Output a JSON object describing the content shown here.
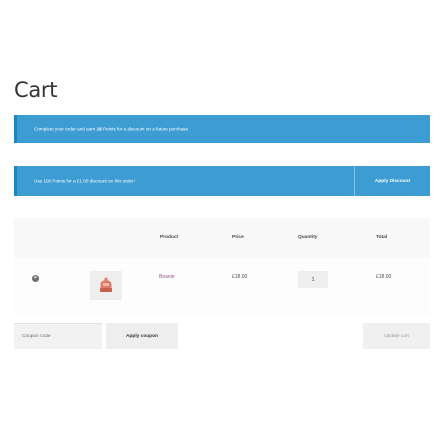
{
  "page": {
    "title": "Cart"
  },
  "notices": {
    "earn": {
      "text_before": "Complete your order and earn ",
      "points": "18",
      "text_after": " Points for a discount on a future purchase"
    },
    "redeem": {
      "text": "Use 100 Points for a £1.00 discount on this order!",
      "button_label": "Apply Discount"
    }
  },
  "cart": {
    "headers": {
      "product": "Product",
      "price": "Price",
      "quantity": "Quantity",
      "total": "Total"
    },
    "items": [
      {
        "remove_symbol": "×",
        "thumbnail_icon": "beanie-product-icon",
        "name": "Beanie",
        "price": "£18.00",
        "quantity": "1",
        "total": "£18.00"
      }
    ]
  },
  "actions": {
    "coupon_placeholder": "Coupon code",
    "apply_coupon_label": "Apply coupon",
    "update_cart_label": "Update cart"
  },
  "colors": {
    "notice_background": "#3d9cd2",
    "link": "#96588a",
    "thumbnail_hat": "#e07a68"
  }
}
